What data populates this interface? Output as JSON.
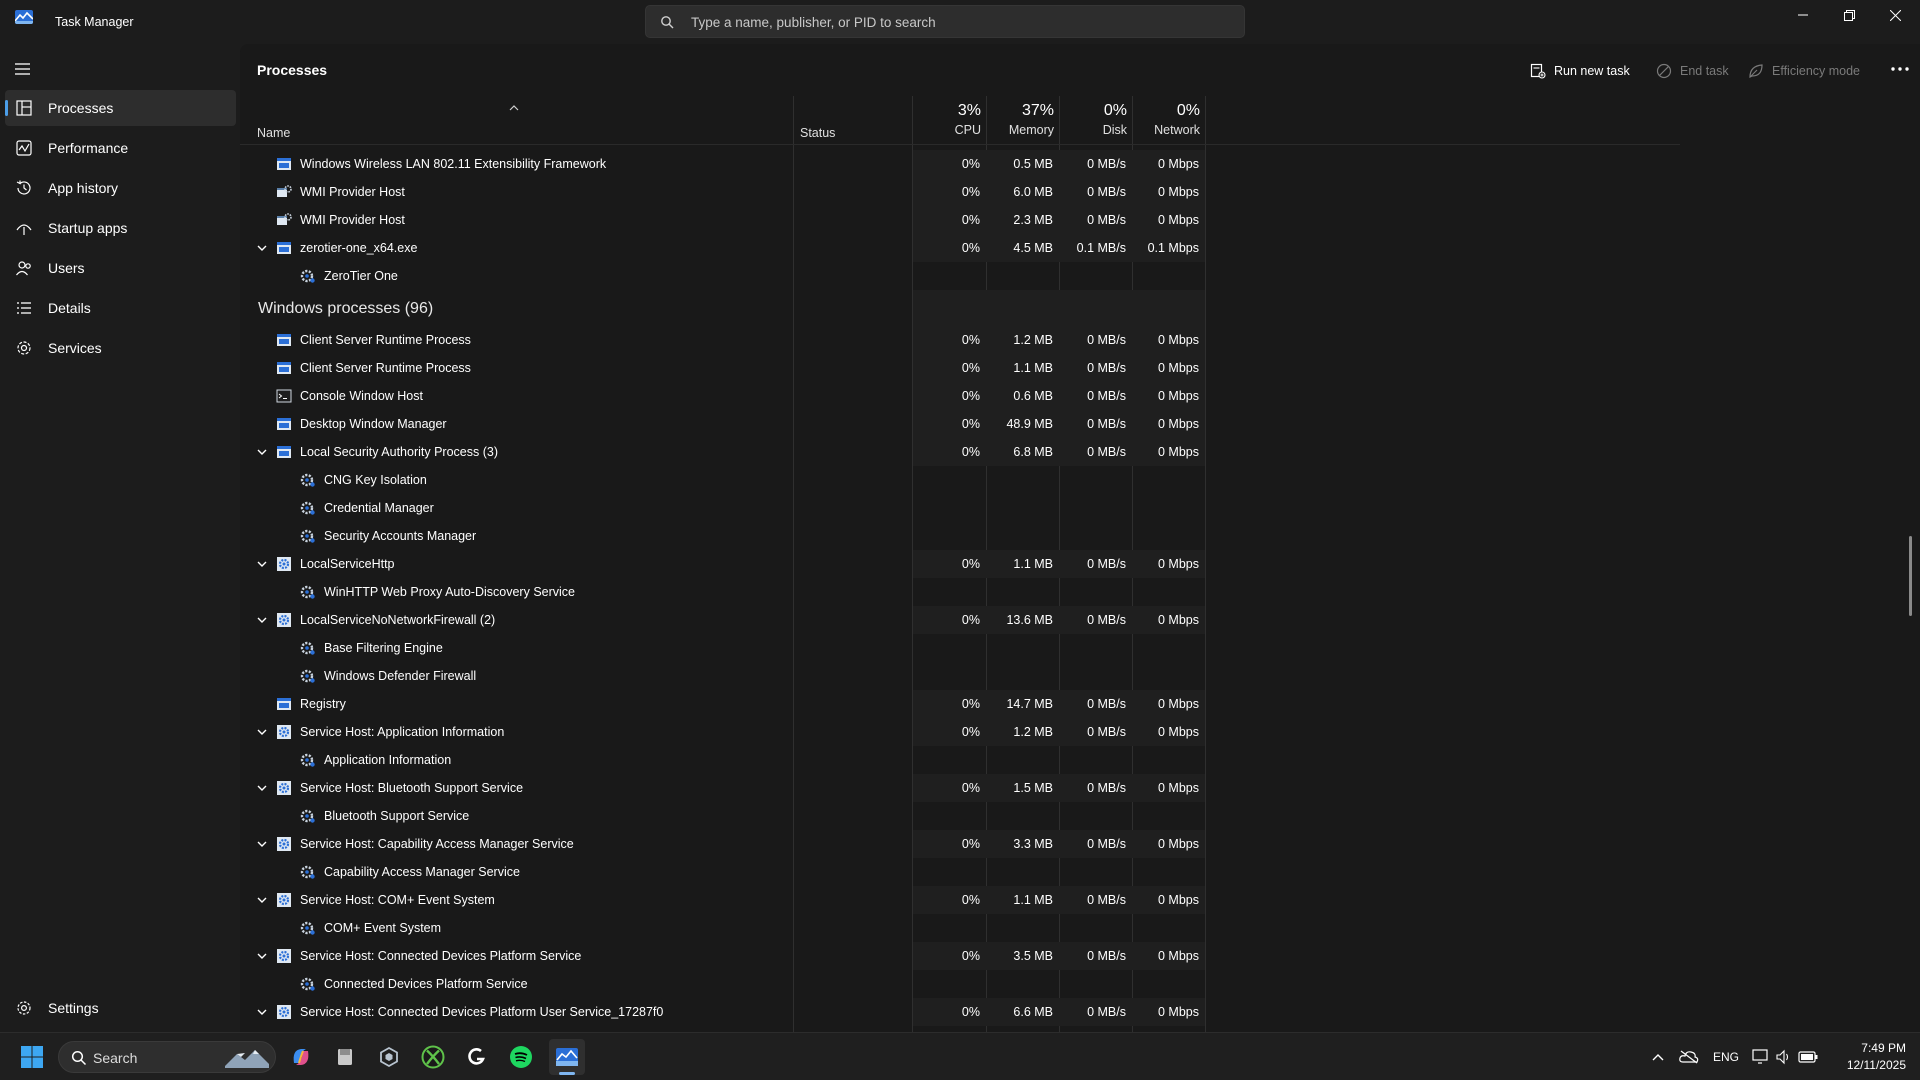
{
  "app": {
    "title": "Task Manager"
  },
  "search": {
    "placeholder": "Type a name, publisher, or PID to search"
  },
  "sidebar": {
    "items": [
      {
        "label": "Processes",
        "icon": "processes-icon",
        "active": true
      },
      {
        "label": "Performance",
        "icon": "performance-icon"
      },
      {
        "label": "App history",
        "icon": "app-history-icon"
      },
      {
        "label": "Startup apps",
        "icon": "startup-apps-icon"
      },
      {
        "label": "Users",
        "icon": "users-icon"
      },
      {
        "label": "Details",
        "icon": "details-icon"
      },
      {
        "label": "Services",
        "icon": "services-icon"
      }
    ],
    "settings_label": "Settings"
  },
  "toolbar": {
    "page_title": "Processes",
    "run_new_task": "Run new task",
    "end_task": "End task",
    "efficiency_mode": "Efficiency mode"
  },
  "columns": {
    "name": "Name",
    "status": "Status",
    "cpu": {
      "pct": "3%",
      "label": "CPU"
    },
    "memory": {
      "pct": "37%",
      "label": "Memory"
    },
    "disk": {
      "pct": "0%",
      "label": "Disk"
    },
    "network": {
      "pct": "0%",
      "label": "Network"
    }
  },
  "rows": [
    {
      "type": "process",
      "name": "Windows Wireless LAN 802.11 Extensibility Framework",
      "icon": "window-app-icon",
      "cpu": "0%",
      "memory": "0.5 MB",
      "disk": "0 MB/s",
      "network": "0 Mbps"
    },
    {
      "type": "process",
      "name": "WMI Provider Host",
      "icon": "wmi-icon",
      "cpu": "0%",
      "memory": "6.0 MB",
      "disk": "0 MB/s",
      "network": "0 Mbps"
    },
    {
      "type": "process",
      "name": "WMI Provider Host",
      "icon": "wmi-icon",
      "cpu": "0%",
      "memory": "2.3 MB",
      "disk": "0 MB/s",
      "network": "0 Mbps"
    },
    {
      "type": "process",
      "expanded": true,
      "name": "zerotier-one_x64.exe",
      "icon": "window-app-icon",
      "cpu": "0%",
      "memory": "4.5 MB",
      "disk": "0.1 MB/s",
      "network": "0.1 Mbps"
    },
    {
      "type": "service",
      "name": "ZeroTier One",
      "icon": "service-gear-icon"
    },
    {
      "type": "group",
      "name": "Windows processes (96)"
    },
    {
      "type": "process",
      "name": "Client Server Runtime Process",
      "icon": "window-app-icon",
      "cpu": "0%",
      "memory": "1.2 MB",
      "disk": "0 MB/s",
      "network": "0 Mbps"
    },
    {
      "type": "process",
      "name": "Client Server Runtime Process",
      "icon": "window-app-icon",
      "cpu": "0%",
      "memory": "1.1 MB",
      "disk": "0 MB/s",
      "network": "0 Mbps"
    },
    {
      "type": "process",
      "name": "Console Window Host",
      "icon": "console-icon",
      "cpu": "0%",
      "memory": "0.6 MB",
      "disk": "0 MB/s",
      "network": "0 Mbps"
    },
    {
      "type": "process",
      "name": "Desktop Window Manager",
      "icon": "window-app-icon",
      "cpu": "0%",
      "memory": "48.9 MB",
      "disk": "0 MB/s",
      "network": "0 Mbps"
    },
    {
      "type": "process",
      "expanded": true,
      "name": "Local Security Authority Process (3)",
      "icon": "window-app-icon",
      "cpu": "0%",
      "memory": "6.8 MB",
      "disk": "0 MB/s",
      "network": "0 Mbps"
    },
    {
      "type": "service",
      "name": "CNG Key Isolation",
      "icon": "service-gear-icon"
    },
    {
      "type": "service",
      "name": "Credential Manager",
      "icon": "service-gear-icon"
    },
    {
      "type": "service",
      "name": "Security Accounts Manager",
      "icon": "service-gear-icon"
    },
    {
      "type": "process",
      "expanded": true,
      "name": "LocalServiceHttp",
      "icon": "service-host-icon",
      "cpu": "0%",
      "memory": "1.1 MB",
      "disk": "0 MB/s",
      "network": "0 Mbps"
    },
    {
      "type": "service",
      "name": "WinHTTP Web Proxy Auto-Discovery Service",
      "icon": "service-gear-icon"
    },
    {
      "type": "process",
      "expanded": true,
      "name": "LocalServiceNoNetworkFirewall (2)",
      "icon": "service-host-icon",
      "cpu": "0%",
      "memory": "13.6 MB",
      "disk": "0 MB/s",
      "network": "0 Mbps"
    },
    {
      "type": "service",
      "name": "Base Filtering Engine",
      "icon": "service-gear-icon"
    },
    {
      "type": "service",
      "name": "Windows Defender Firewall",
      "icon": "service-gear-icon"
    },
    {
      "type": "process",
      "name": "Registry",
      "icon": "window-app-icon",
      "cpu": "0%",
      "memory": "14.7 MB",
      "disk": "0 MB/s",
      "network": "0 Mbps"
    },
    {
      "type": "process",
      "expanded": true,
      "name": "Service Host: Application Information",
      "icon": "service-host-icon",
      "cpu": "0%",
      "memory": "1.2 MB",
      "disk": "0 MB/s",
      "network": "0 Mbps"
    },
    {
      "type": "service",
      "name": "Application Information",
      "icon": "service-gear-icon"
    },
    {
      "type": "process",
      "expanded": true,
      "name": "Service Host: Bluetooth Support Service",
      "icon": "service-host-icon",
      "cpu": "0%",
      "memory": "1.5 MB",
      "disk": "0 MB/s",
      "network": "0 Mbps"
    },
    {
      "type": "service",
      "name": "Bluetooth Support Service",
      "icon": "service-gear-icon"
    },
    {
      "type": "process",
      "expanded": true,
      "name": "Service Host: Capability Access Manager Service",
      "icon": "service-host-icon",
      "cpu": "0%",
      "memory": "3.3 MB",
      "disk": "0 MB/s",
      "network": "0 Mbps"
    },
    {
      "type": "service",
      "name": "Capability Access Manager Service",
      "icon": "service-gear-icon"
    },
    {
      "type": "process",
      "expanded": true,
      "name": "Service Host: COM+ Event System",
      "icon": "service-host-icon",
      "cpu": "0%",
      "memory": "1.1 MB",
      "disk": "0 MB/s",
      "network": "0 Mbps"
    },
    {
      "type": "service",
      "name": "COM+ Event System",
      "icon": "service-gear-icon"
    },
    {
      "type": "process",
      "expanded": true,
      "name": "Service Host: Connected Devices Platform Service",
      "icon": "service-host-icon",
      "cpu": "0%",
      "memory": "3.5 MB",
      "disk": "0 MB/s",
      "network": "0 Mbps"
    },
    {
      "type": "service",
      "name": "Connected Devices Platform Service",
      "icon": "service-gear-icon"
    },
    {
      "type": "process",
      "expanded": true,
      "name": "Service Host: Connected Devices Platform User Service_17287f0",
      "icon": "service-host-icon",
      "cpu": "0%",
      "memory": "6.6 MB",
      "disk": "0 MB/s",
      "network": "0 Mbps"
    }
  ],
  "taskbar": {
    "search_label": "Search",
    "pinned": [
      "windows-start-icon",
      "copilot-icon",
      "file-icon",
      "app-icon",
      "xbox-icon",
      "logitech-icon",
      "spotify-icon",
      "task-manager-icon"
    ],
    "tray_lang": "ENG",
    "time": "7:49 PM",
    "date": "12/11/2025"
  },
  "colors": {
    "accent": "#4c9ee8",
    "background": "#1c1c1c",
    "panel": "#191919"
  }
}
